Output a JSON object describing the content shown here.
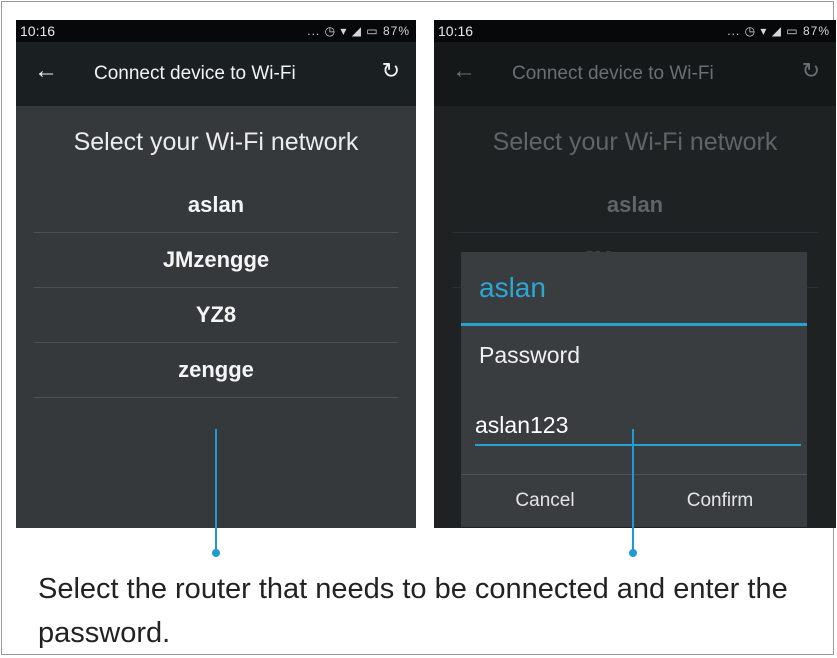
{
  "left_screen": {
    "status_time": "10:16",
    "status_icons": "... ◷ ▾ ◢ ▭ 87%",
    "back_icon": "←",
    "title": "Connect device to Wi-Fi",
    "refresh_icon": "↻",
    "heading": "Select your Wi-Fi network",
    "networks": [
      "aslan",
      "JMzengge",
      "YZ8",
      "zengge"
    ]
  },
  "right_screen": {
    "status_time": "10:16",
    "status_icons": "... ◷ ▾ ◢ ▭ 87%",
    "back_icon": "←",
    "title": "Connect device to Wi-Fi",
    "refresh_icon": "↻",
    "heading": "Select your Wi-Fi network",
    "networks": [
      "aslan",
      "JMzengge"
    ],
    "dialog": {
      "title": "aslan",
      "password_label": "Password",
      "password_value": "aslan123",
      "cancel_label": "Cancel",
      "confirm_label": "Confirm"
    }
  },
  "caption": "Select the router that needs to be connected and enter the password.",
  "colors": {
    "accent": "#27a3d2",
    "pointer": "#1f9ad7"
  }
}
